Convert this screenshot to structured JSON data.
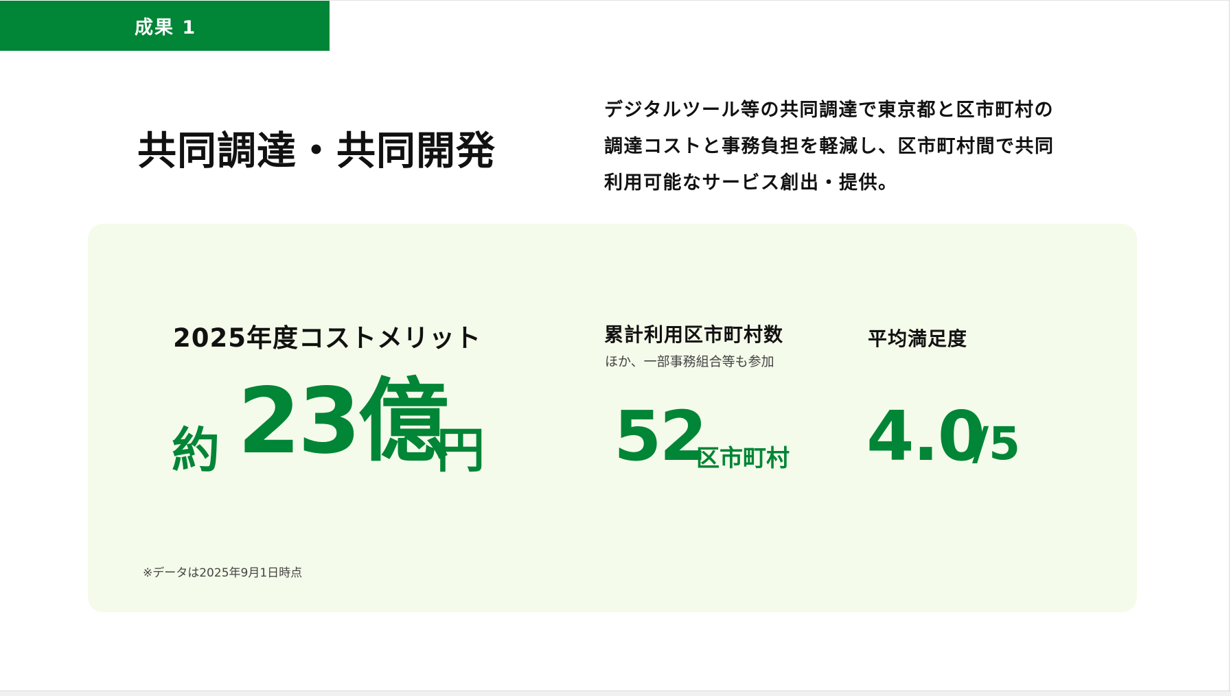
{
  "badge": {
    "label": "成果 1"
  },
  "header": {
    "title": "共同調達・共同開発",
    "description_lines": [
      "デジタルツール等の共同調達で東京都と区市町村の",
      "調達コストと事務負担を軽減し、区市町村間で共同",
      "利用可能なサービス創出・提供。"
    ]
  },
  "metrics": {
    "cost_merit": {
      "label": "2025年度コストメリット",
      "prefix": "約",
      "value": "23億",
      "unit": "円"
    },
    "municipalities": {
      "label": "累計利用区市町村数",
      "sublabel": "ほか、一部事務組合等も参加",
      "value": "52",
      "unit": "区市町村"
    },
    "satisfaction": {
      "label": "平均満足度",
      "value": "4.0",
      "unit": "/5"
    }
  },
  "footnote": "※データは2025年9月1日時点",
  "colors": {
    "accent_green": "#018536",
    "panel_background": "#f4fbea",
    "text_dark": "#111111"
  }
}
